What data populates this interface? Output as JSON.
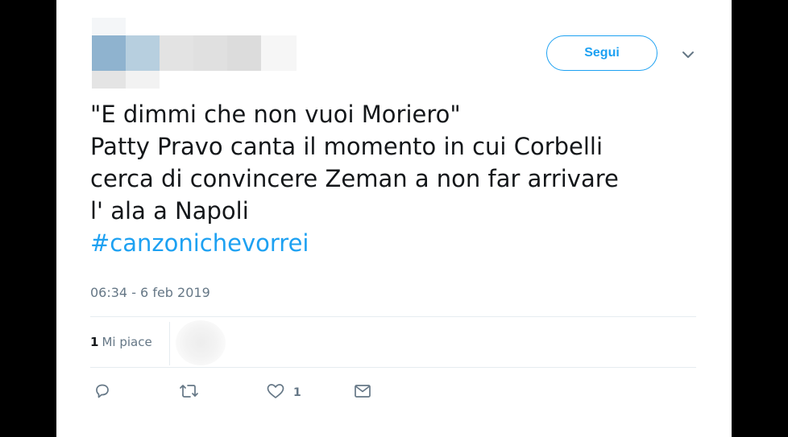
{
  "tweet": {
    "text_lines": [
      "\"E dimmi che non vuoi Moriero\"",
      "Patty Pravo canta il momento in cui Corbelli",
      "cerca di convincere Zeman a non far arrivare",
      "l' ala a Napoli"
    ],
    "hashtag": "#canzonichevorrei",
    "timestamp": "06:34 - 6 feb 2019"
  },
  "header": {
    "follow_label": "Segui",
    "menu_icon": "chevron-down-icon"
  },
  "stats": {
    "likes_count": "1",
    "likes_label": "Mi piace"
  },
  "actions": {
    "reply_icon": "reply-icon",
    "retweet_icon": "retweet-icon",
    "like_icon": "heart-icon",
    "like_count": "1",
    "message_icon": "envelope-icon"
  },
  "colors": {
    "accent": "#1da1f2",
    "text": "#14171a",
    "muted": "#657786",
    "background": "#000000",
    "card": "#ffffff"
  }
}
